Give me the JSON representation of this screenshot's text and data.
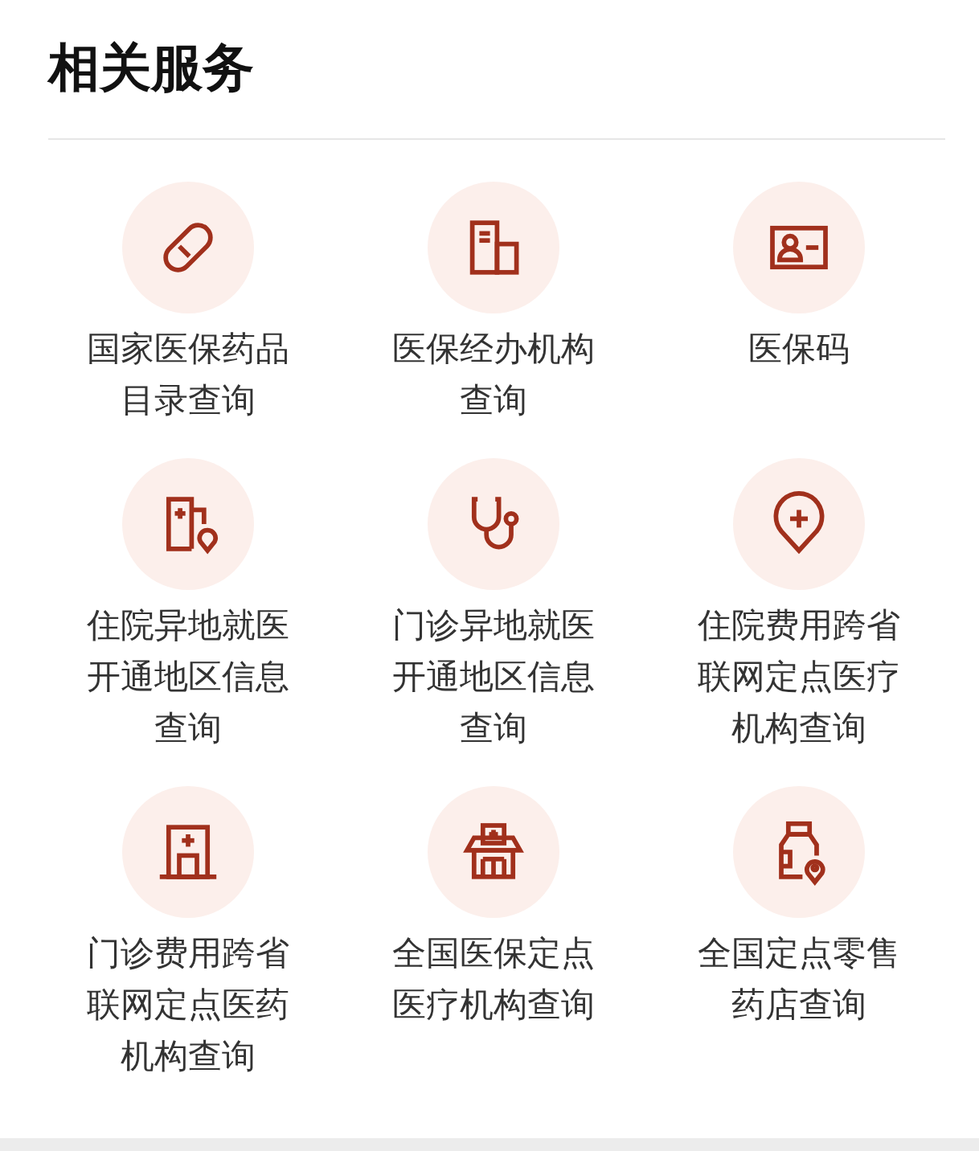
{
  "title": "相关服务",
  "services": [
    {
      "label": "国家医保药品目录查询",
      "kind": "pill"
    },
    {
      "label": "医保经办机构查询",
      "kind": "building"
    },
    {
      "label": "医保码",
      "kind": "card"
    },
    {
      "label": "住院异地就医开通地区信息查询",
      "kind": "hospital-pin"
    },
    {
      "label": "门诊异地就医开通地区信息查询",
      "kind": "stethoscope"
    },
    {
      "label": "住院费用跨省联网定点医疗机构查询",
      "kind": "pin"
    },
    {
      "label": "门诊费用跨省联网定点医药机构查询",
      "kind": "hospital"
    },
    {
      "label": "全国医保定点医疗机构查询",
      "kind": "pharmacy"
    },
    {
      "label": "全国定点零售药店查询",
      "kind": "bottle"
    }
  ]
}
